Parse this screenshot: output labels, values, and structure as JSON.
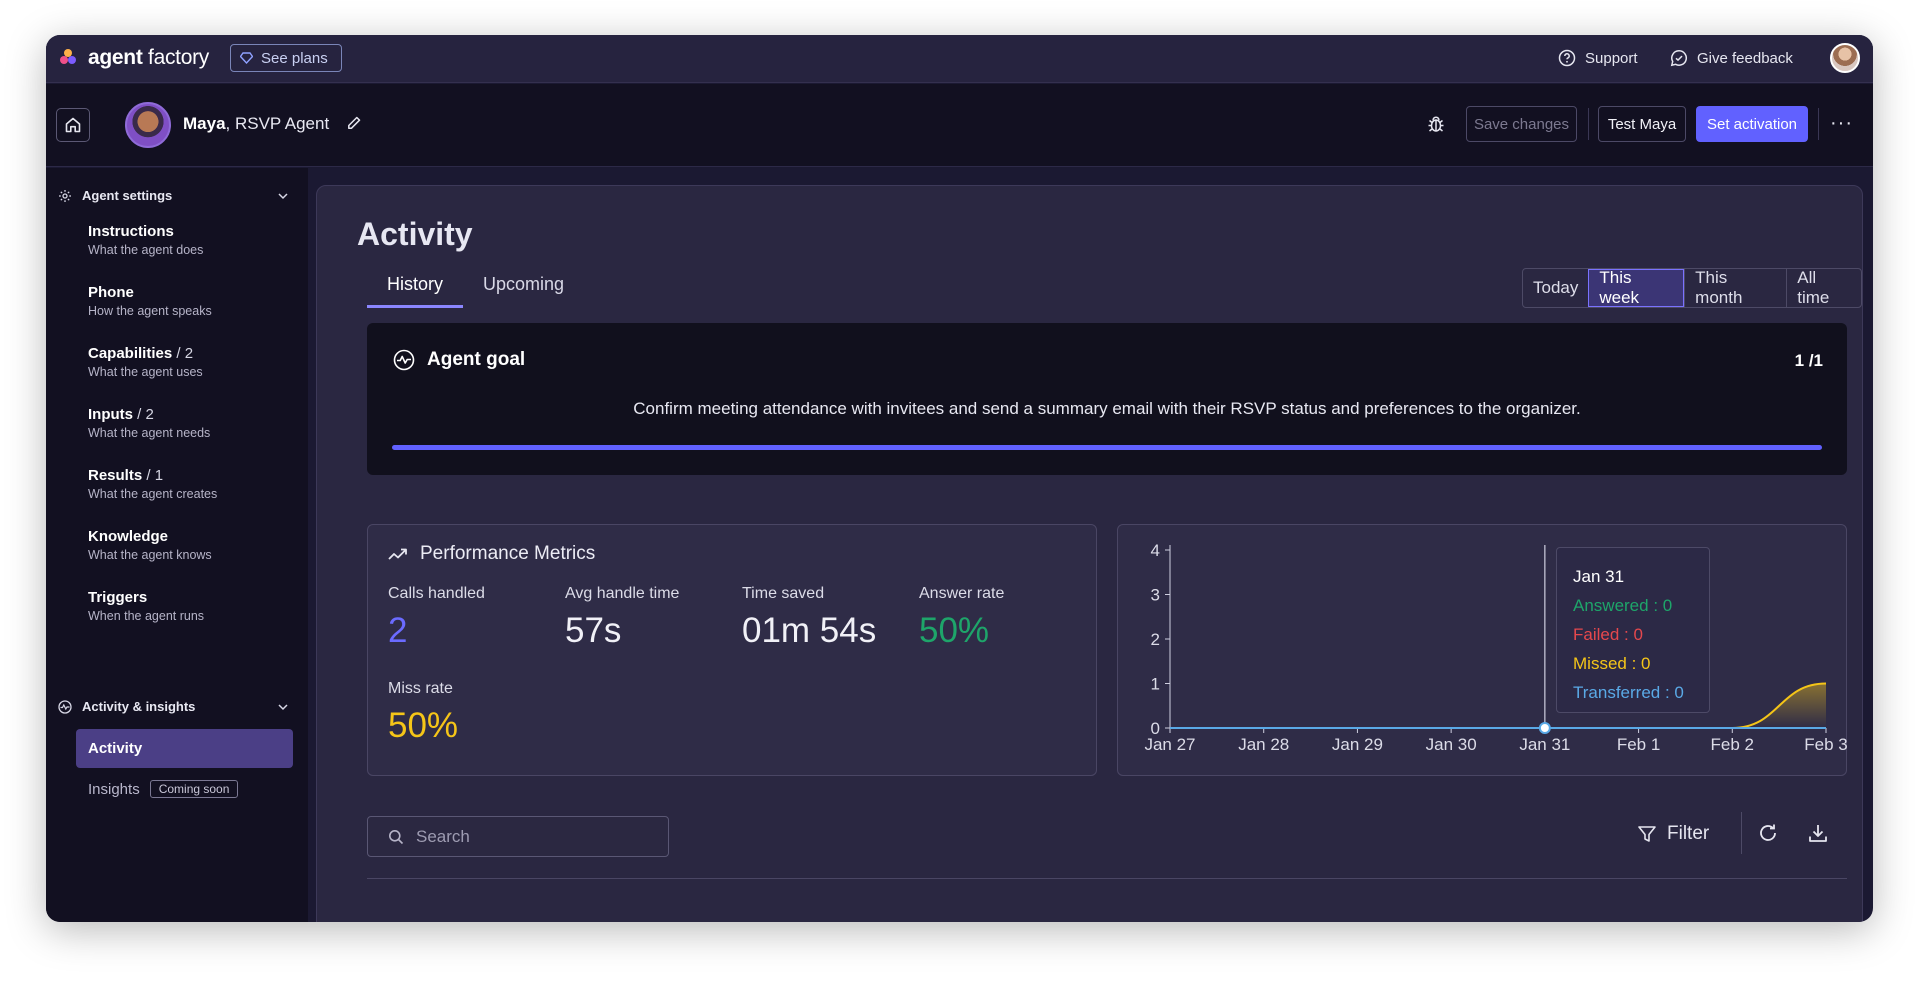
{
  "topbar": {
    "brand_bold": "agent",
    "brand_rest": " factory",
    "see_plans": "See plans",
    "support": "Support",
    "give_feedback": "Give feedback"
  },
  "header": {
    "agent_name": "Maya",
    "agent_role": ", RSVP Agent",
    "save_changes": "Save changes",
    "test": "Test Maya",
    "set_activation": "Set activation",
    "more": "···"
  },
  "sidebar": {
    "agent_settings": "Agent settings",
    "items": [
      {
        "title": "Instructions",
        "count": "",
        "sub": "What the agent does"
      },
      {
        "title": "Phone",
        "count": "",
        "sub": "How the agent speaks"
      },
      {
        "title": "Capabilities",
        "count": " / 2",
        "sub": "What the agent uses"
      },
      {
        "title": "Inputs",
        "count": " / 2",
        "sub": "What the agent needs"
      },
      {
        "title": "Results",
        "count": " / 1",
        "sub": "What the agent creates"
      },
      {
        "title": "Knowledge",
        "count": "",
        "sub": "What the agent knows"
      },
      {
        "title": "Triggers",
        "count": "",
        "sub": "When the agent runs"
      }
    ],
    "activity_insights": "Activity & insights",
    "activity": "Activity",
    "insights": "Insights",
    "coming_soon": "Coming soon"
  },
  "main": {
    "title": "Activity",
    "tabs": [
      "History",
      "Upcoming"
    ],
    "range": [
      "Today",
      "This week",
      "This month",
      "All time"
    ],
    "range_selected": "This week",
    "goal": {
      "title": "Agent goal",
      "count": "1 /1",
      "description": "Confirm meeting attendance with invitees and send a summary email with their RSVP status and preferences to the organizer.",
      "progress": 1.0
    },
    "performance": {
      "title": "Performance Metrics",
      "metrics": [
        {
          "label": "Calls handled",
          "value": "2",
          "color": "#6b6bff"
        },
        {
          "label": "Avg handle time",
          "value": "57s",
          "color": "#f1f1f7"
        },
        {
          "label": "Time saved",
          "value": "01m 54s",
          "color": "#f1f1f7"
        },
        {
          "label": "Answer rate",
          "value": "50%",
          "color": "#1ea56a"
        },
        {
          "label": "Miss rate",
          "value": "50%",
          "color": "#f5c518"
        }
      ]
    },
    "search_placeholder": "Search",
    "filter": "Filter"
  },
  "chart_data": {
    "type": "area",
    "categories": [
      "Jan 27",
      "Jan 28",
      "Jan 29",
      "Jan 30",
      "Jan 31",
      "Feb 1",
      "Feb 2",
      "Feb 3"
    ],
    "y_ticks": [
      "0",
      "1",
      "2",
      "3",
      "4"
    ],
    "ylim": [
      0,
      4
    ],
    "series": [
      {
        "name": "Answered",
        "color": "#1ea56a",
        "values": [
          0,
          0,
          0,
          0,
          0,
          0,
          0,
          0
        ]
      },
      {
        "name": "Failed",
        "color": "#e5484d",
        "values": [
          0,
          0,
          0,
          0,
          0,
          0,
          0,
          0
        ]
      },
      {
        "name": "Missed",
        "color": "#f5c518",
        "values": [
          0,
          0,
          0,
          0,
          0,
          0,
          0,
          1
        ]
      },
      {
        "name": "Transferred",
        "color": "#5aa9e6",
        "values": [
          0,
          0,
          0,
          0,
          0,
          0,
          0,
          0
        ]
      }
    ],
    "tooltip": {
      "date": "Jan 31",
      "lines": [
        "Answered : 0",
        "Failed : 0",
        "Missed : 0",
        "Transferred : 0"
      ]
    }
  }
}
